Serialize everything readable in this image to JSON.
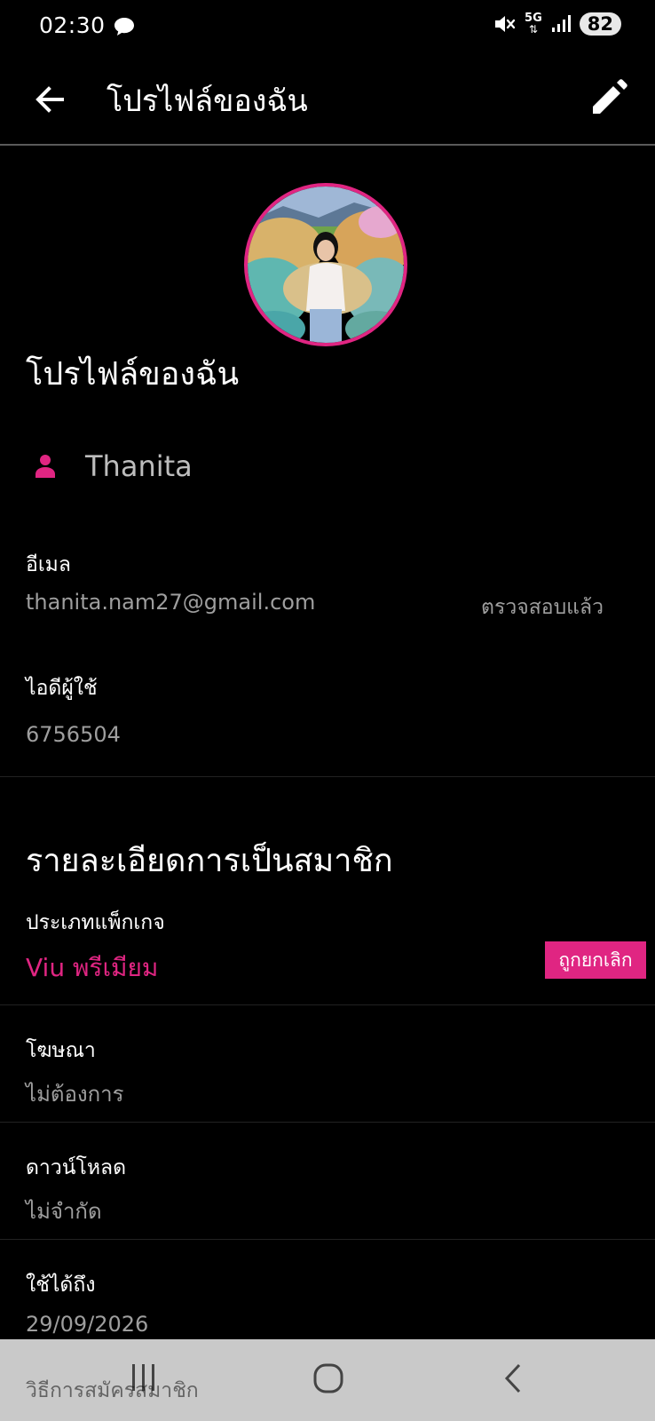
{
  "status_bar": {
    "time": "02:30",
    "network": "5G",
    "battery": "82",
    "icons": [
      "chat-bubble-icon",
      "mute-icon",
      "network-5g-icon",
      "signal-icon",
      "battery-icon"
    ]
  },
  "app_bar": {
    "title": "โปรไฟล์ของฉัน",
    "icons": [
      "back-arrow-icon",
      "edit-pencil-icon"
    ]
  },
  "profile": {
    "heading": "โปรไฟล์ของฉัน",
    "username": "Thanita",
    "email_label": "อีเมล",
    "email": "thanita.nam27@gmail.com",
    "email_status": "ตรวจสอบแล้ว",
    "user_id_label": "ไอดีผู้ใช้",
    "user_id": "6756504"
  },
  "membership": {
    "heading": "รายละเอียดการเป็นสมาชิก",
    "package_label": "ประเภทแพ็กเกจ",
    "package_value": "Viu พรีเมียม",
    "package_status": "ถูกยกเลิก",
    "ads_label": "โฆษณา",
    "ads_value": "ไม่ต้องการ",
    "download_label": "ดาวน์โหลด",
    "download_value": "ไม่จำกัด",
    "valid_until_label": "ใช้ได้ถึง",
    "valid_until_value": "29/09/2026",
    "signup_method_label": "วิธีการสมัครสมาชิก"
  },
  "colors": {
    "accent": "#e02582",
    "background": "#000000",
    "nav_bar": "#c9c9c9"
  },
  "nav_bar": {
    "icons": [
      "recent-apps-icon",
      "home-icon",
      "back-icon"
    ]
  }
}
